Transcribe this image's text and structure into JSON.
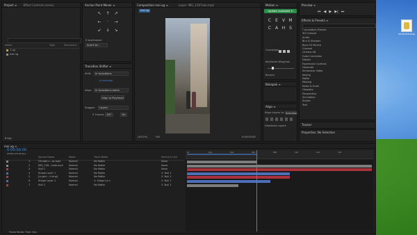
{
  "colors": {
    "accent": "#2d8ceb",
    "green": "#2d8c4a",
    "track_red": "#a8333d",
    "track_gray": "#7d7d7d",
    "track_blue": "#4c6fb8",
    "playhead": "#2d8ceb"
  },
  "project": {
    "tab1": "Project ≡",
    "tab2": "Effect Controls (none)",
    "search_placeholder": "",
    "col_name": "Name",
    "col_type": "Type",
    "col_doc": "Document",
    "items": [
      {
        "name": "1 ug",
        "type": ""
      },
      {
        "name": "mai ug",
        "type": ""
      }
    ],
    "footer": "8 bpc"
  },
  "anchor": {
    "title": "Anchor Point Mover ≡",
    "keyframed": "If keyframed:",
    "select_label": "Insert ke...",
    "arrows": [
      "↖",
      "↑",
      "↗",
      "←",
      "·",
      "→",
      "↙",
      "↓",
      "↘"
    ]
  },
  "transition": {
    "title": "Transition Shifter ≡",
    "shift": "Shift:",
    "shift_val": "In transitions",
    "in_seconds": "in seconds",
    "align": "Align:",
    "align_val": "In transitions starts",
    "align_btn": "Align to Playhead",
    "stagger": "Stagger:",
    "stagger_val": "Layers",
    "frames": "0",
    "frames_label": "frames",
    "order": "ASC",
    "do": "Do"
  },
  "comp": {
    "tab_comp": "Composition mai ug ≡",
    "tab_layer": "Layer: IMG_1567sdo.mp4",
    "comp_label": "mai ug",
    "zoom": "(49.2%)",
    "res": "Full",
    "time": "0:00:00:00"
  },
  "motion": {
    "title": "Motion ≡",
    "update_btn": "Update available ↻",
    "icons": [
      "C",
      "E",
      "V",
      "M",
      "C",
      "A",
      "H",
      "S"
    ],
    "overshoot": "Overshoot",
    "keyframe": "Keyframe Wingman",
    "bounce": "Bounce"
  },
  "align": {
    "title": "Align ≡",
    "align_to": "Align Layers to:",
    "selection": "Selection",
    "distribute": "Distribute Layers"
  },
  "bakapak": {
    "title": "Bakapak ≡"
  },
  "preview": {
    "title": "Preview ≡",
    "controls": [
      "⏮",
      "◀",
      "▶",
      "▶|",
      "⏭"
    ]
  },
  "effects": {
    "title": "Effects & Presets ≡",
    "search": "",
    "items": [
      "* Animation Presets",
      "3D Channel",
      "Audio",
      "Blur & Sharpen",
      "Boris FX Mocha",
      "Channel",
      "Cinema 4D",
      "Color Correction",
      "Distort",
      "Expression Controls",
      "Generate",
      "Immersive Video",
      "Keying",
      "Matte",
      "Missing",
      "Noise & Grain",
      "Obsolete",
      "Perspective",
      "Simulation",
      "Stylize",
      "Text"
    ]
  },
  "tracker": {
    "title": "Tracker"
  },
  "properties": {
    "title": "Properties: No Selection"
  },
  "timeline": {
    "tab": "mai ug ≡",
    "timecode": "0:00:00:00",
    "fps": "00000 (25.00 fps)",
    "headers": {
      "src": "Source Name",
      "mode": "Mode",
      "trkmat": "Track Matte",
      "parent": "Parent & Link"
    },
    "ruler": [
      "0s",
      "02s",
      "04s",
      "06s",
      "08s",
      "10s",
      "12s",
      "14s"
    ],
    "layers": [
      {
        "n": "1",
        "name": "Y2mate.c...ss.mp4",
        "mode": "Normal",
        "matte": "No Matte",
        "parent": "None",
        "color": "#8a8a8a"
      },
      {
        "n": "2",
        "name": "IMG_156...2sdo.mp4",
        "mode": "Normal",
        "matte": "No Matte",
        "parent": "None",
        "color": "#8a8a8a"
      },
      {
        "n": "3",
        "name": "Null 1",
        "mode": "Normal",
        "matte": "No Matte",
        "parent": "None",
        "color": "#b03a45"
      },
      {
        "n": "4",
        "name": "Shape Layer 1",
        "mode": "Normal",
        "matte": "No Matte",
        "parent": "3. Null 1",
        "color": "#4c6fb8"
      },
      {
        "n": "5",
        "name": "[rcuprt-...h.tmp]",
        "mode": "Normal",
        "matte": "No Matte",
        "parent": "3. Null 1",
        "color": "#b03a45"
      },
      {
        "n": "6",
        "name": "Shape Layer 1",
        "mode": "Normal",
        "matte": "4. Shape La v",
        "parent": "3. Null 1",
        "color": "#4c6fb8"
      },
      {
        "n": "7",
        "name": "Null 1",
        "mode": "Normal",
        "matte": "No Matte",
        "parent": "3. Null 1",
        "color": "#b03a45"
      }
    ],
    "footer": "Frame Render Time: 5ms"
  },
  "desktop": {
    "file_label": "sunshine.png"
  }
}
